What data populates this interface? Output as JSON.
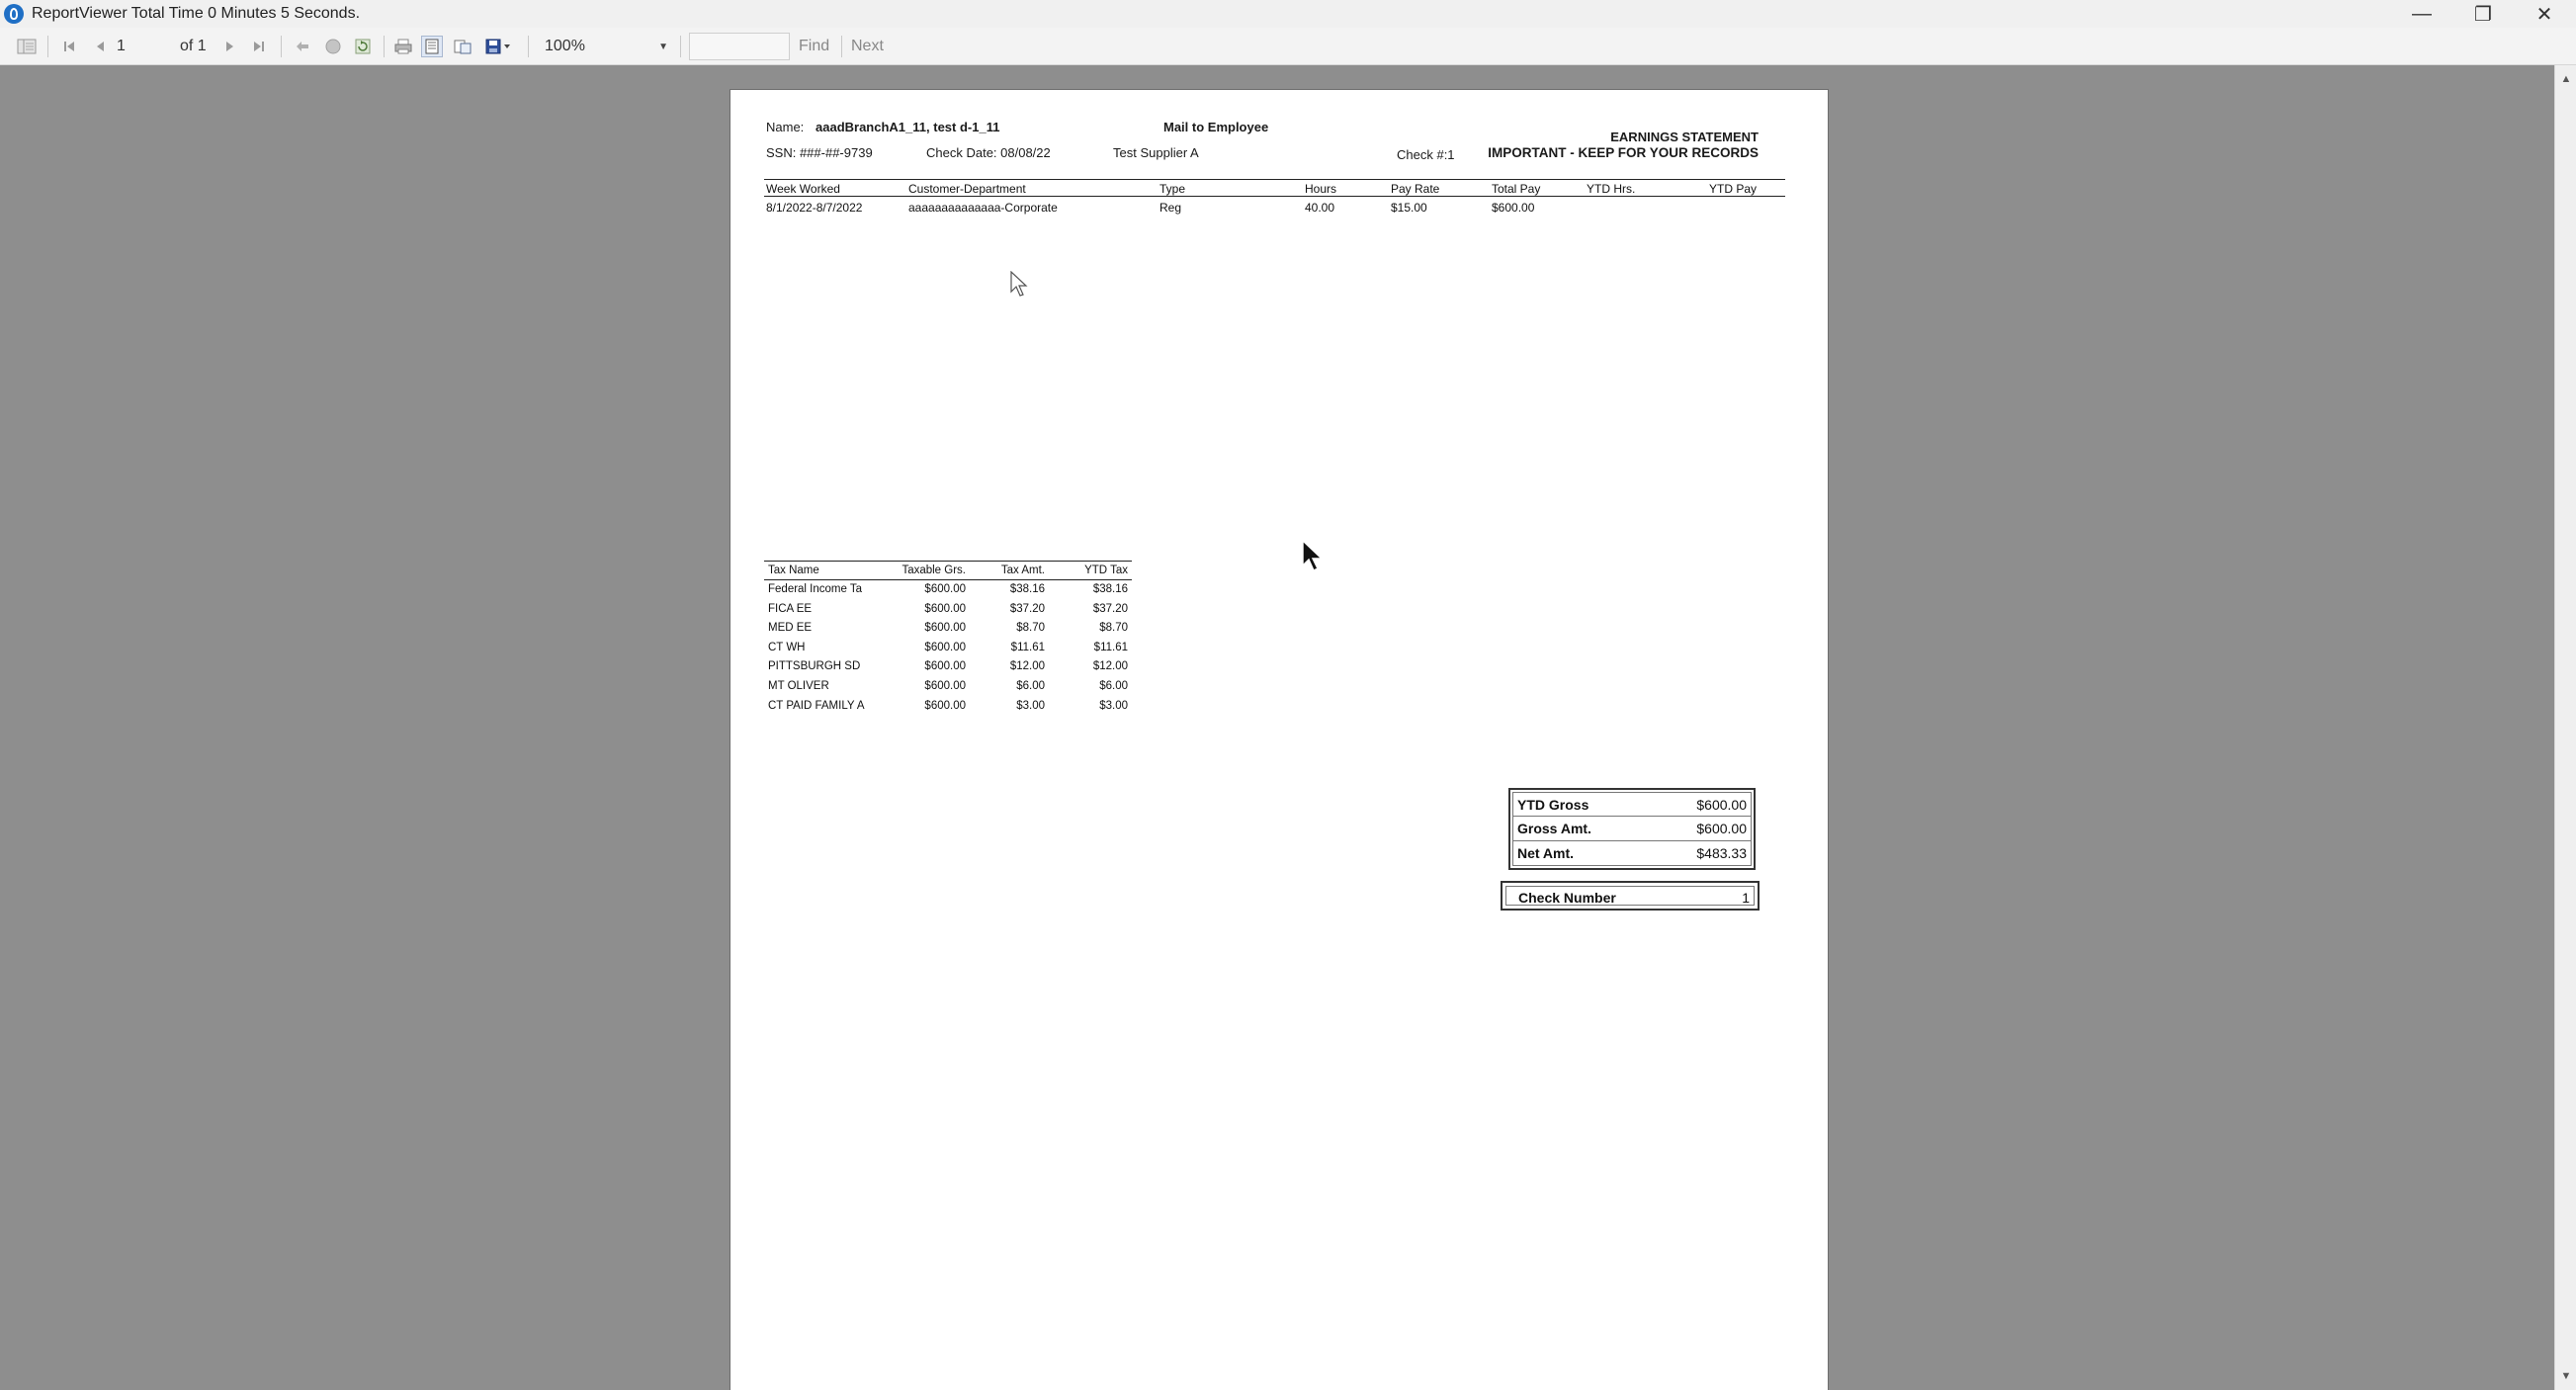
{
  "window": {
    "title": "ReportViewer  Total Time 0 Minutes 5 Seconds.",
    "minimize_glyph": "—",
    "restore_glyph": "❐",
    "close_glyph": "✕"
  },
  "toolbar": {
    "current_page": "1",
    "page_of": "of 1",
    "zoom": "100%",
    "find_value": "",
    "find_label": "Find",
    "next_label": "Next",
    "icons": [
      "document-map-icon",
      "first-page-icon",
      "previous-page-icon",
      "next-page-icon",
      "last-page-icon",
      "back-icon",
      "stop-icon",
      "refresh-icon",
      "print-icon",
      "print-layout-icon",
      "page-setup-icon",
      "export-icon"
    ]
  },
  "report": {
    "name_label": "Name:",
    "name_value": "aaadBranchA1_11, test d-1_11",
    "mail_to": "Mail to Employee",
    "statement_title": "EARNINGS STATEMENT",
    "statement_subtitle": "IMPORTANT - KEEP FOR YOUR RECORDS",
    "ssn": "SSN: ###-##-9739",
    "check_date": "Check Date: 08/08/22",
    "supplier": "Test Supplier A",
    "check_no": "Check #:1",
    "work_columns": [
      "Week Worked",
      "Customer-Department",
      "Type",
      "Hours",
      "Pay Rate",
      "Total Pay",
      "YTD Hrs.",
      "YTD Pay"
    ],
    "work_rows": [
      {
        "week": "8/1/2022-8/7/2022",
        "department": "aaaaaaaaaaaaaa-Corporate",
        "type": "Reg",
        "hours": "40.00",
        "rate": "$15.00",
        "total": "$600.00",
        "ytd_hrs": "",
        "ytd_pay": ""
      }
    ],
    "tax_columns": [
      "Tax Name",
      "Taxable Grs.",
      "Tax Amt.",
      "YTD Tax"
    ],
    "tax_rows": [
      {
        "name": "Federal Income Ta",
        "taxable": "$600.00",
        "amount": "$38.16",
        "ytd": "$38.16"
      },
      {
        "name": "FICA EE",
        "taxable": "$600.00",
        "amount": "$37.20",
        "ytd": "$37.20"
      },
      {
        "name": "MED EE",
        "taxable": "$600.00",
        "amount": "$8.70",
        "ytd": "$8.70"
      },
      {
        "name": "CT WH",
        "taxable": "$600.00",
        "amount": "$11.61",
        "ytd": "$11.61"
      },
      {
        "name": "PITTSBURGH SD",
        "taxable": "$600.00",
        "amount": "$12.00",
        "ytd": "$12.00"
      },
      {
        "name": "MT OLIVER",
        "taxable": "$600.00",
        "amount": "$6.00",
        "ytd": "$6.00"
      },
      {
        "name": "CT PAID FAMILY A",
        "taxable": "$600.00",
        "amount": "$3.00",
        "ytd": "$3.00"
      }
    ],
    "summary": [
      {
        "label": "YTD Gross",
        "value": "$600.00"
      },
      {
        "label": "Gross Amt.",
        "value": "$600.00"
      },
      {
        "label": "Net Amt.",
        "value": "$483.33"
      }
    ],
    "check_number_label": "Check Number",
    "check_number_value": "1"
  },
  "colors": {
    "workspace": "#8e8e8e",
    "paper": "#ffffff",
    "toolbar": "#f3f3f3",
    "app_icon": "#1f6fc5"
  }
}
